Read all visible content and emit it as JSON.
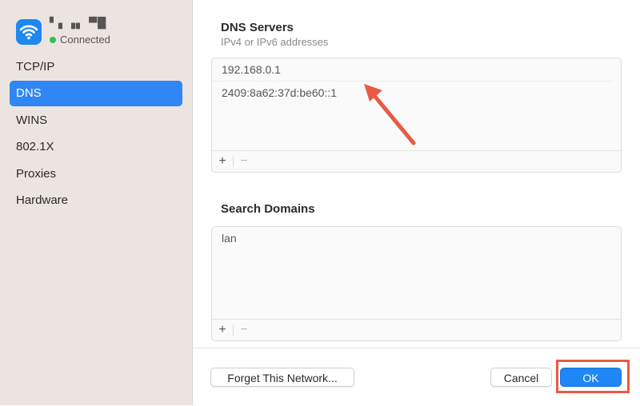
{
  "sidebar": {
    "network_name": "▘▖▗▖ ▀█",
    "status": "Connected",
    "items": [
      {
        "label": "TCP/IP",
        "active": false
      },
      {
        "label": "DNS",
        "active": true
      },
      {
        "label": "WINS",
        "active": false
      },
      {
        "label": "802.1X",
        "active": false
      },
      {
        "label": "Proxies",
        "active": false
      },
      {
        "label": "Hardware",
        "active": false
      }
    ]
  },
  "dns": {
    "title": "DNS Servers",
    "subtitle": "IPv4 or IPv6 addresses",
    "servers": [
      "192.168.0.1",
      "2409:8a62:37d:be60::1"
    ],
    "add_label": "+",
    "remove_label": "−"
  },
  "search": {
    "title": "Search Domains",
    "domains": [
      "lan"
    ],
    "add_label": "+",
    "remove_label": "−"
  },
  "footer": {
    "forget_label": "Forget This Network...",
    "cancel_label": "Cancel",
    "ok_label": "OK"
  },
  "colors": {
    "accent": "#1e86f5",
    "annotation": "#e85a45",
    "status_green": "#2fc24a"
  },
  "icons": {
    "wifi": "wifi-icon",
    "arrow": "annotation-arrow-icon"
  }
}
